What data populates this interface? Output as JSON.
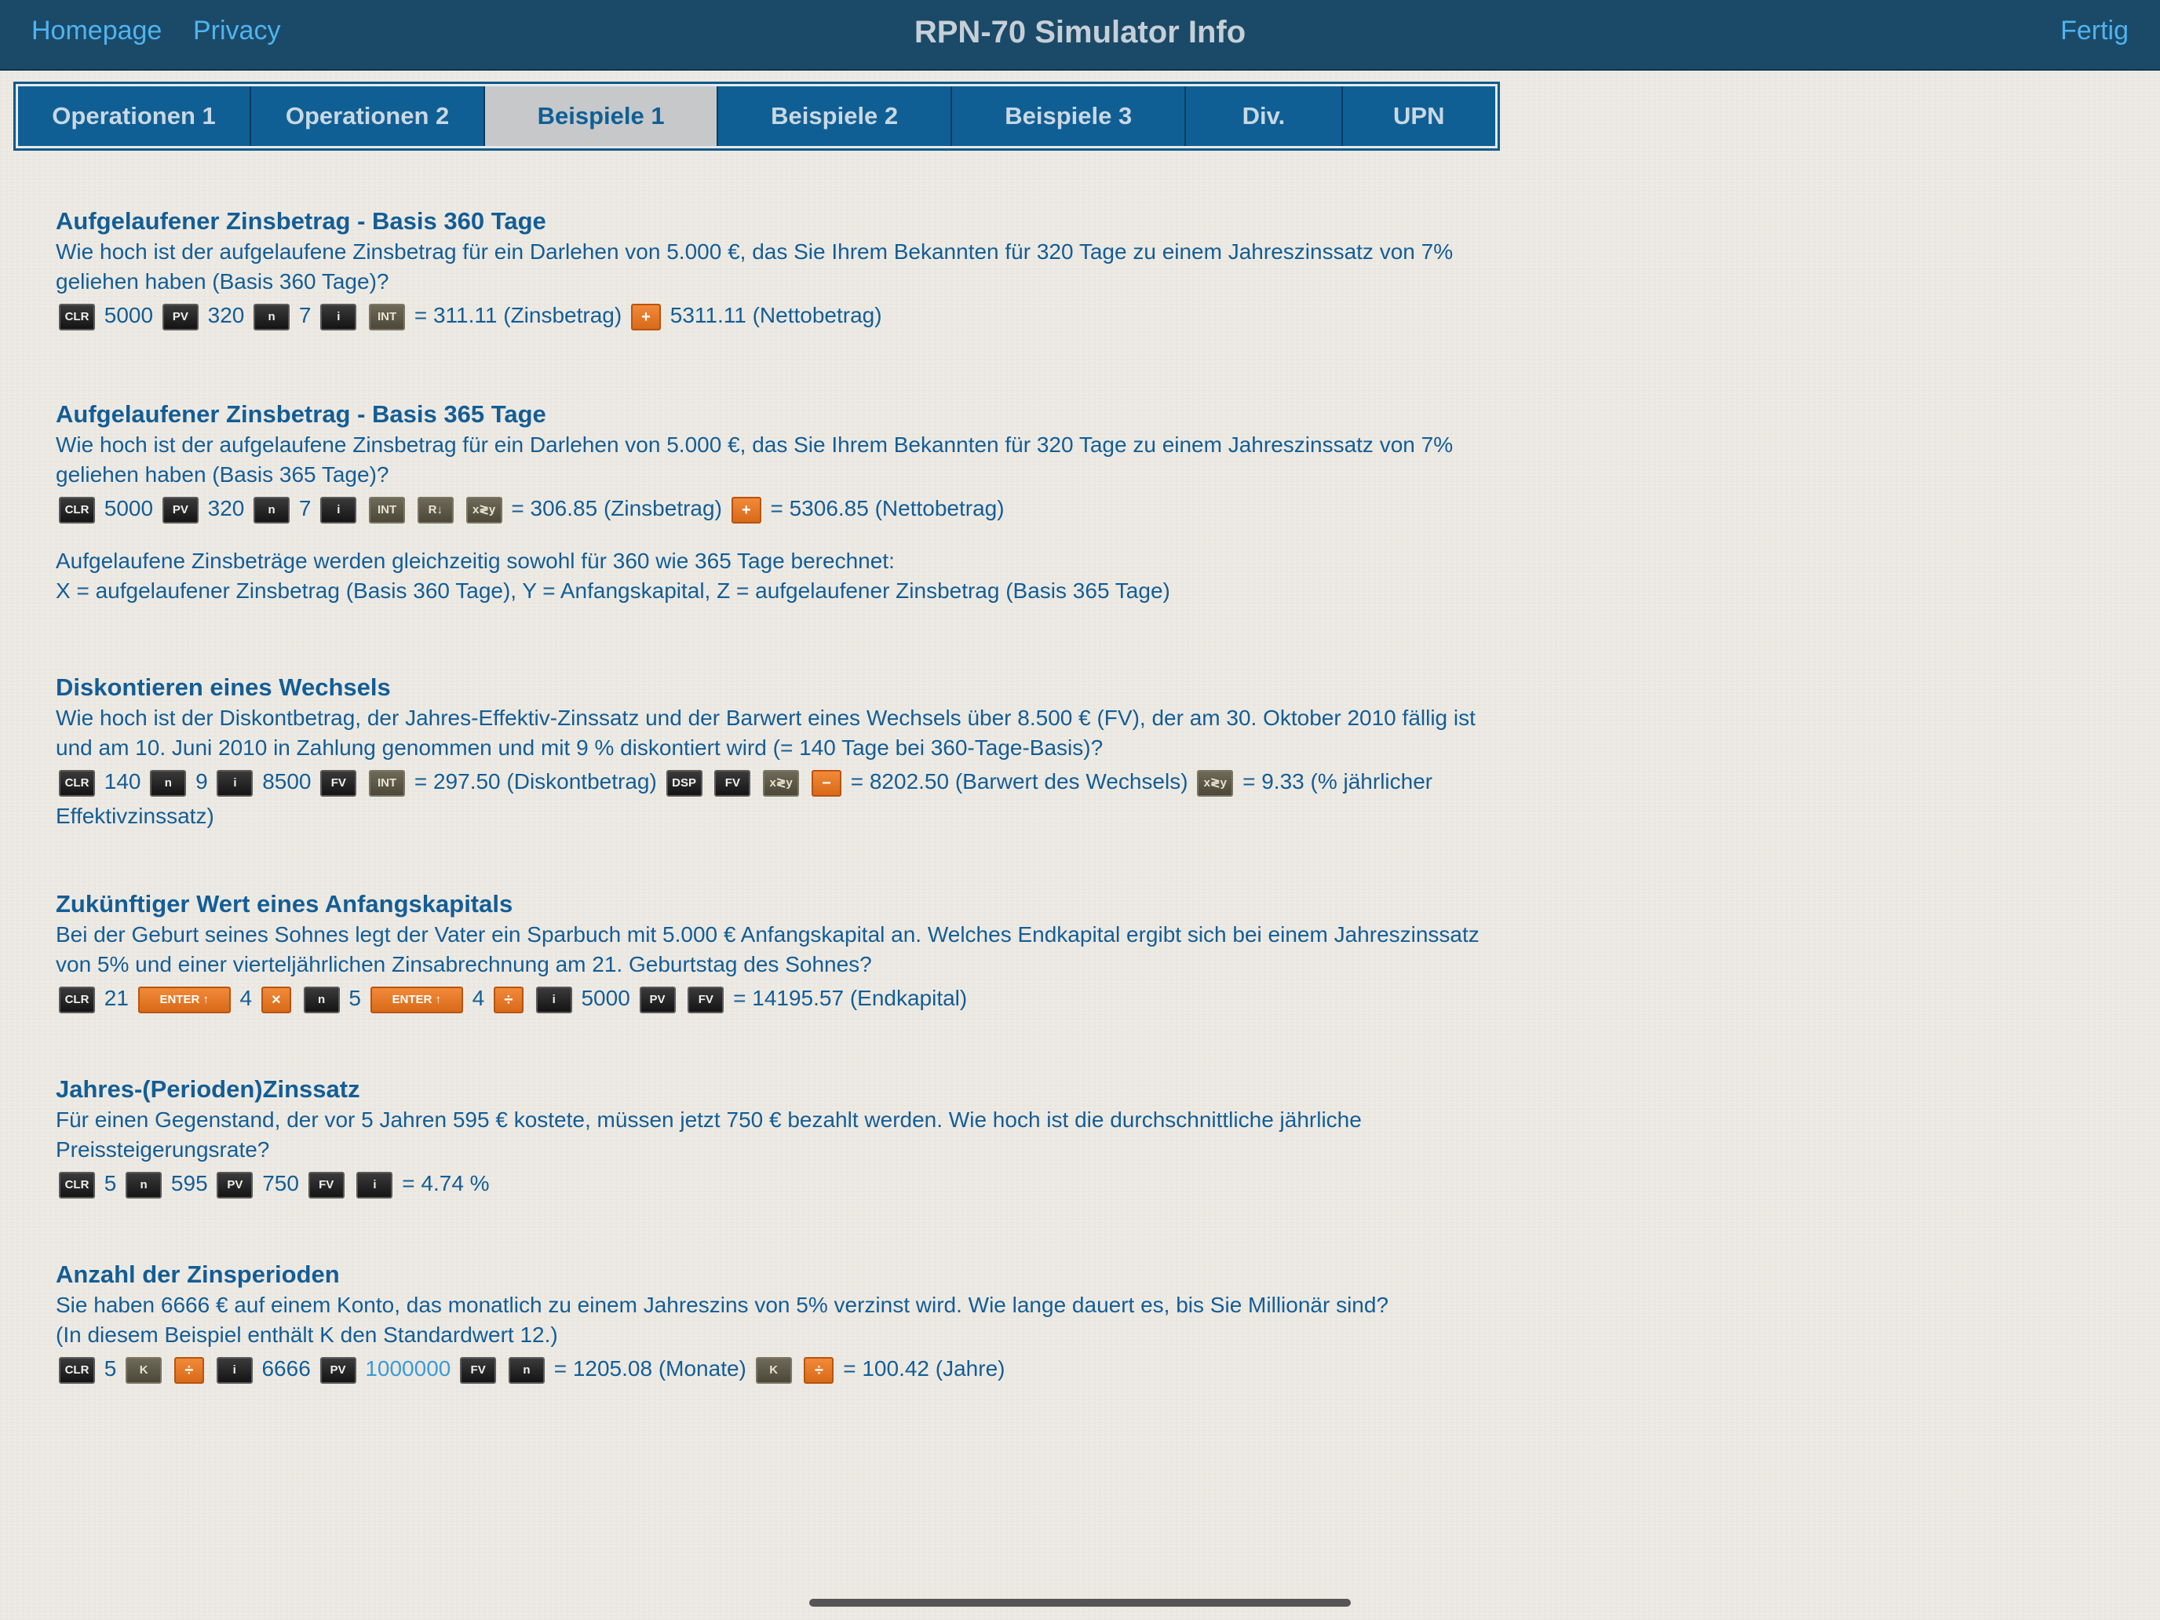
{
  "nav": {
    "homepage": "Homepage",
    "privacy": "Privacy",
    "title": "RPN-70 Simulator Info",
    "done": "Fertig"
  },
  "tabs": [
    {
      "label": "Operationen 1",
      "active": false
    },
    {
      "label": "Operationen 2",
      "active": false
    },
    {
      "label": "Beispiele 1",
      "active": true
    },
    {
      "label": "Beispiele 2",
      "active": false
    },
    {
      "label": "Beispiele 3",
      "active": false
    },
    {
      "label": "Div.",
      "active": false
    },
    {
      "label": "UPN",
      "active": false
    }
  ],
  "sections": [
    {
      "title": "Aufgelaufener Zinsbetrag - Basis 360 Tage",
      "text": "Wie hoch ist der aufgelaufene Zinsbetrag für ein Darlehen von 5.000 €, das Sie Ihrem Bekannten für 320 Tage zu einem Jahreszinssatz von 7% geliehen haben (Basis 360 Tage)?",
      "keys": {
        "clr": "CLR",
        "pv": "PV",
        "n": "n",
        "i": "i",
        "int": "INT",
        "plus": "+"
      },
      "values": [
        "5000",
        "320",
        "7"
      ],
      "result1": "= 311.11 (Zinsbetrag)",
      "result2": "5311.11 (Nettobetrag)"
    },
    {
      "title": "Aufgelaufener Zinsbetrag - Basis 365 Tage",
      "text": "Wie hoch ist der aufgelaufene Zinsbetrag für ein Darlehen von 5.000 €, das Sie Ihrem Bekannten für 320 Tage zu einem Jahreszinssatz von 7% geliehen haben (Basis 365 Tage)?",
      "keys": {
        "clr": "CLR",
        "pv": "PV",
        "n": "n",
        "i": "i",
        "int": "INT",
        "rdown": "R↓",
        "xy": "x≷y",
        "plus": "+"
      },
      "values": [
        "5000",
        "320",
        "7"
      ],
      "result1": "= 306.85 (Zinsbetrag)",
      "result2": "= 5306.85 (Nettobetrag)",
      "note1": "Aufgelaufene Zinsbeträge werden gleichzeitig sowohl für 360 wie 365 Tage berechnet:",
      "note2": "X = aufgelaufener Zinsbetrag (Basis 360 Tage), Y = Anfangskapital, Z = aufgelaufener Zinsbetrag (Basis 365 Tage)"
    },
    {
      "title": "Diskontieren eines Wechsels",
      "text": "Wie hoch ist der Diskontbetrag, der Jahres-Effektiv-Zinssatz und der Barwert eines Wechsels über 8.500 € (FV), der am 30. Oktober 2010 fällig ist und am 10. Juni 2010 in Zahlung genommen und mit 9 % diskontiert wird (= 140 Tage bei 360-Tage-Basis)?",
      "keys": {
        "clr": "CLR",
        "n": "n",
        "i": "i",
        "fv": "FV",
        "int": "INT",
        "dsp": "DSP",
        "xy": "x≷y",
        "minus": "−"
      },
      "values": [
        "140",
        "9",
        "8500"
      ],
      "result1": "= 297.50 (Diskontbetrag)",
      "result2": "= 8202.50 (Barwert des Wechsels)",
      "result3": "= 9.33 (% jährlicher Effektivzinssatz)"
    },
    {
      "title": "Zukünftiger Wert eines Anfangskapitals",
      "text": "Bei der Geburt seines Sohnes legt der Vater ein Sparbuch mit 5.000 € Anfangskapital an. Welches Endkapital ergibt sich bei einem Jahreszinssatz von 5% und einer vierteljährlichen Zinsabrechnung am 21. Geburtstag des Sohnes?",
      "keys": {
        "clr": "CLR",
        "enter": "ENTER ↑",
        "times": "×",
        "n": "n",
        "div": "÷",
        "i": "i",
        "pv": "PV",
        "fv": "FV"
      },
      "values": [
        "21",
        "4",
        "5",
        "4",
        "5000"
      ],
      "result1": "= 14195.57 (Endkapital)"
    },
    {
      "title": "Jahres-(Perioden)Zinssatz",
      "text": "Für einen Gegenstand, der vor 5 Jahren 595 € kostete, müssen jetzt 750 € bezahlt werden. Wie hoch ist die durchschnittliche jährliche Preissteigerungsrate?",
      "keys": {
        "clr": "CLR",
        "n": "n",
        "pv": "PV",
        "fv": "FV",
        "i": "i"
      },
      "values": [
        "5",
        "595",
        "750"
      ],
      "result1": "= 4.74 %"
    },
    {
      "title": "Anzahl der Zinsperioden",
      "text": "Sie haben 6666 € auf einem Konto, das monatlich zu einem Jahreszins von 5% verzinst wird. Wie lange dauert es, bis Sie Millionär sind?",
      "text2": "(In diesem Beispiel enthält K den Standardwert 12.)",
      "keys": {
        "clr": "CLR",
        "k": "K",
        "div": "÷",
        "i": "i",
        "pv": "PV",
        "fv": "FV",
        "n": "n"
      },
      "values": [
        "5",
        "6666",
        "1000000"
      ],
      "result1": "= 1205.08 (Monate)",
      "result2": "= 100.42 (Jahre)"
    }
  ]
}
